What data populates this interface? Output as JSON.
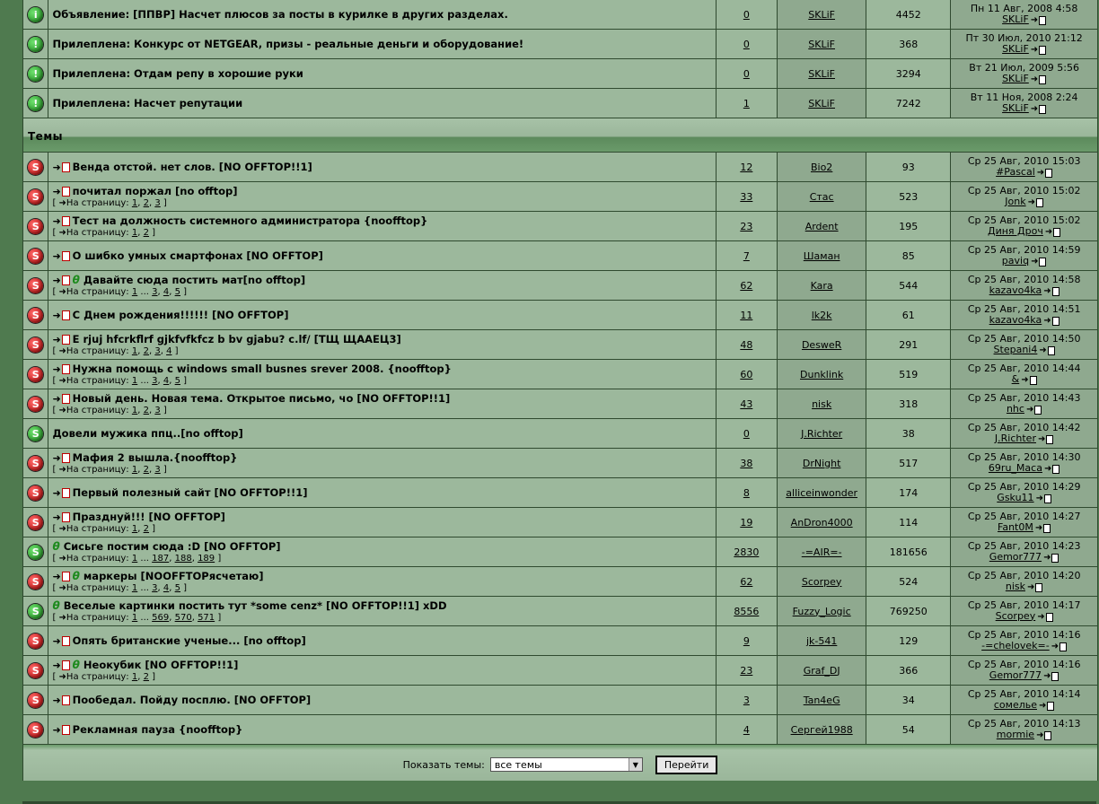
{
  "announcements": [
    {
      "icon": "info",
      "title": "Объявление: [ППВР] Насчет плюсов за посты в курилке в других разделах.",
      "replies": "0",
      "author": "SKLiF",
      "views": "4452",
      "last_date": "Пн 11 Авг, 2008 4:58",
      "last_user": "SKLiF"
    },
    {
      "icon": "sticky",
      "title": "Прилеплена: Конкурс от NETGEAR, призы - реальные деньги и оборудование!",
      "replies": "0",
      "author": "SKLiF",
      "views": "368",
      "last_date": "Пт 30 Июл, 2010 21:12",
      "last_user": "SKLiF"
    },
    {
      "icon": "sticky",
      "title": "Прилеплена: Отдам репу в хорошие руки",
      "replies": "0",
      "author": "SKLiF",
      "views": "3294",
      "last_date": "Вт 21 Июл, 2009 5:56",
      "last_user": "SKLiF"
    },
    {
      "icon": "sticky",
      "title": "Прилеплена: Насчет репутации",
      "replies": "1",
      "author": "SKLiF",
      "views": "7242",
      "last_date": "Вт 11 Ноя, 2008 2:24",
      "last_user": "SKLiF"
    }
  ],
  "section_title": "Темы",
  "pages_prefix": "На страницу:",
  "topics": [
    {
      "status": "closed",
      "new": true,
      "clip": false,
      "title": "Венда отстой. нет слов. [NO OFFTOP!!1]",
      "pages": null,
      "replies": "12",
      "author": "Bio2",
      "views": "93",
      "last_date": "Ср 25 Авг, 2010 15:03",
      "last_user": "#Pascal"
    },
    {
      "status": "closed",
      "new": true,
      "clip": false,
      "title": "почитал поржал [no offtop]",
      "pages": [
        "1",
        ", ",
        "2",
        ", ",
        "3"
      ],
      "replies": "33",
      "author": "Стас",
      "views": "523",
      "last_date": "Ср 25 Авг, 2010 15:02",
      "last_user": "Jonk"
    },
    {
      "status": "closed",
      "new": true,
      "clip": false,
      "title": "Тест на должность системного администратора {noofftop}",
      "pages": [
        "1",
        ", ",
        "2"
      ],
      "replies": "23",
      "author": "Ardent",
      "views": "195",
      "last_date": "Ср 25 Авг, 2010 15:02",
      "last_user": "Диня Дроч"
    },
    {
      "status": "closed",
      "new": true,
      "clip": false,
      "title": "О шибко умных смартфонах [NO OFFTOP]",
      "pages": null,
      "replies": "7",
      "author": "Шаман",
      "views": "85",
      "last_date": "Ср 25 Авг, 2010 14:59",
      "last_user": "paviq"
    },
    {
      "status": "closed",
      "new": true,
      "clip": true,
      "title": "Давайте сюда постить мат[no offtop]",
      "pages": [
        "1",
        " ... ",
        "3",
        ", ",
        "4",
        ", ",
        "5"
      ],
      "replies": "62",
      "author": "Kara",
      "views": "544",
      "last_date": "Ср 25 Авг, 2010 14:58",
      "last_user": "kazavo4ka"
    },
    {
      "status": "closed",
      "new": true,
      "clip": false,
      "title": "С Днем рождения!!!!!! [NO OFFTOP]",
      "pages": null,
      "replies": "11",
      "author": "lk2k",
      "views": "61",
      "last_date": "Ср 25 Авг, 2010 14:51",
      "last_user": "kazavo4ka"
    },
    {
      "status": "closed",
      "new": true,
      "clip": false,
      "title": "E rjuj hfcrkflrf gjkfvfkfcz b bv gjabu? c.lf/ [ТЩ ЩААЕЦ3]",
      "pages": [
        "1",
        ", ",
        "2",
        ", ",
        "3",
        ", ",
        "4"
      ],
      "replies": "48",
      "author": "DesweR",
      "views": "291",
      "last_date": "Ср 25 Авг, 2010 14:50",
      "last_user": "Stepani4"
    },
    {
      "status": "closed",
      "new": true,
      "clip": false,
      "title": "Нужна помощь с windows small busnes srever 2008. {noofftop}",
      "pages": [
        "1",
        " ... ",
        "3",
        ", ",
        "4",
        ", ",
        "5"
      ],
      "replies": "60",
      "author": "Dunklink",
      "views": "519",
      "last_date": "Ср 25 Авг, 2010 14:44",
      "last_user": "&"
    },
    {
      "status": "closed",
      "new": true,
      "clip": false,
      "title": "Новый день. Новая тема. Открытое письмо, чо [NO OFFTOP!!1]",
      "pages": [
        "1",
        ", ",
        "2",
        ", ",
        "3"
      ],
      "replies": "43",
      "author": "nisk",
      "views": "318",
      "last_date": "Ср 25 Авг, 2010 14:43",
      "last_user": "nhc"
    },
    {
      "status": "open",
      "new": false,
      "clip": false,
      "title": "Довели мужика ппц..[no offtop]",
      "pages": null,
      "replies": "0",
      "author": "J.Richter",
      "views": "38",
      "last_date": "Ср 25 Авг, 2010 14:42",
      "last_user": "J.Richter"
    },
    {
      "status": "closed",
      "new": true,
      "clip": false,
      "title": "Мафия 2 вышла.{noofftop}",
      "pages": [
        "1",
        ", ",
        "2",
        ", ",
        "3"
      ],
      "replies": "38",
      "author": "DrNight",
      "views": "517",
      "last_date": "Ср 25 Авг, 2010 14:30",
      "last_user": "69ru_Maca"
    },
    {
      "status": "closed",
      "new": true,
      "clip": false,
      "title": "Первый полезный сайт [NO OFFTOP!!1]",
      "pages": null,
      "replies": "8",
      "author": "alliceinwonder",
      "views": "174",
      "last_date": "Ср 25 Авг, 2010 14:29",
      "last_user": "Gsku11"
    },
    {
      "status": "closed",
      "new": true,
      "clip": false,
      "title": "Празднуй!!! [NO OFFTOP]",
      "pages": [
        "1",
        ", ",
        "2"
      ],
      "replies": "19",
      "author": "AnDron4000",
      "views": "114",
      "last_date": "Ср 25 Авг, 2010 14:27",
      "last_user": "Fant0M"
    },
    {
      "status": "open",
      "new": false,
      "clip": true,
      "title": "Сисьге постим сюда :D [NO OFFTOP]",
      "pages": [
        "1",
        " ... ",
        "187",
        ", ",
        "188",
        ", ",
        "189"
      ],
      "replies": "2830",
      "author": "-=AIR=-",
      "views": "181656",
      "last_date": "Ср 25 Авг, 2010 14:23",
      "last_user": "Gemor777"
    },
    {
      "status": "closed",
      "new": true,
      "clip": true,
      "title": "маркеры [NOOFFTOPясчетаю]",
      "pages": [
        "1",
        " ... ",
        "3",
        ", ",
        "4",
        ", ",
        "5"
      ],
      "replies": "62",
      "author": "Scorpey",
      "views": "524",
      "last_date": "Ср 25 Авг, 2010 14:20",
      "last_user": "nisk"
    },
    {
      "status": "open",
      "new": false,
      "clip": true,
      "title": "Веселые картинки постить тут *some cenz* [NO OFFTOP!!1] xDD",
      "pages": [
        "1",
        " ... ",
        "569",
        ", ",
        "570",
        ", ",
        "571"
      ],
      "replies": "8556",
      "author": "Fuzzy_Logic",
      "views": "769250",
      "last_date": "Ср 25 Авг, 2010 14:17",
      "last_user": "Scorpey"
    },
    {
      "status": "closed",
      "new": true,
      "clip": false,
      "title": "Опять британские ученые... [no offtop]",
      "pages": null,
      "replies": "9",
      "author": "jk-541",
      "views": "129",
      "last_date": "Ср 25 Авг, 2010 14:16",
      "last_user": "-=chelovek=-"
    },
    {
      "status": "closed",
      "new": true,
      "clip": true,
      "title": "Неокубик [NO OFFTOP!!1]",
      "pages": [
        "1",
        ", ",
        "2"
      ],
      "replies": "23",
      "author": "Graf_DJ",
      "views": "366",
      "last_date": "Ср 25 Авг, 2010 14:16",
      "last_user": "Gemor777"
    },
    {
      "status": "closed",
      "new": true,
      "clip": false,
      "title": "Пообедал. Пойду посплю. [NO OFFTOP]",
      "pages": null,
      "replies": "3",
      "author": "Tan4eG",
      "views": "34",
      "last_date": "Ср 25 Авг, 2010 14:14",
      "last_user": "сомелье"
    },
    {
      "status": "closed",
      "new": true,
      "clip": false,
      "title": "Рекламная пауза {noofftop}",
      "pages": null,
      "replies": "4",
      "author": "Сергей1988",
      "views": "54",
      "last_date": "Ср 25 Авг, 2010 14:13",
      "last_user": "mormie"
    }
  ],
  "footer": {
    "label": "Показать темы:",
    "select_value": "все темы",
    "button": "Перейти"
  }
}
